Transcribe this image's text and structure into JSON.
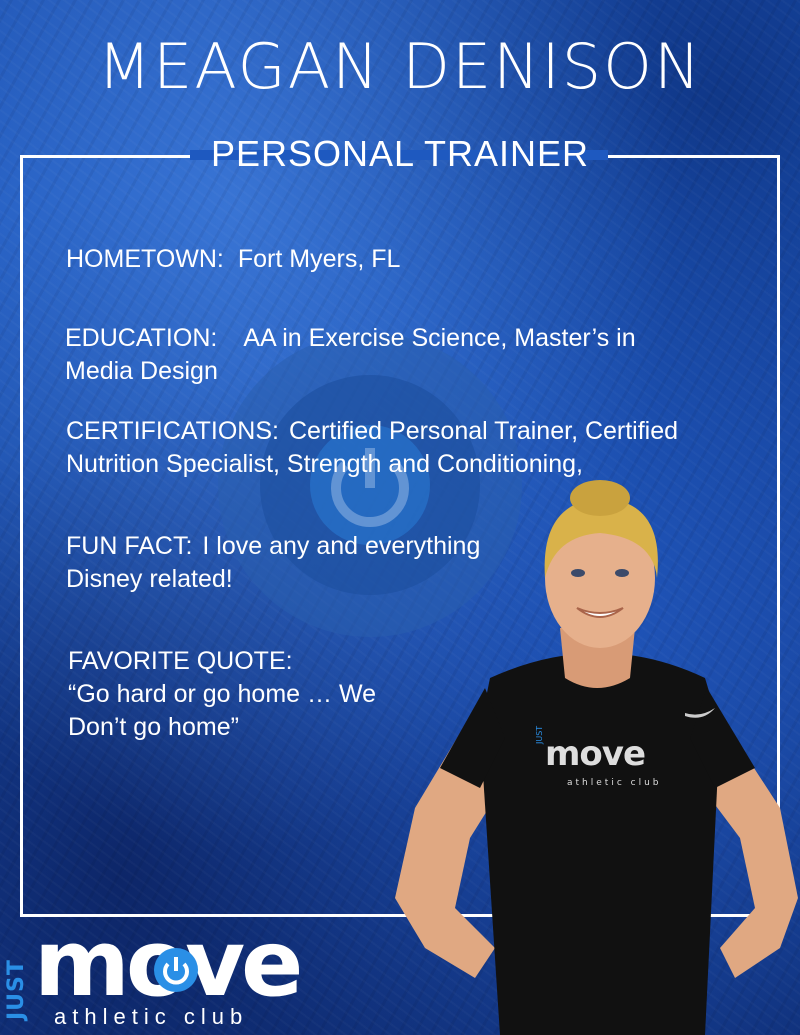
{
  "header": {
    "name": "MEAGAN DENISON",
    "role": "PERSONAL TRAINER"
  },
  "profile": {
    "hometown": {
      "label": "HOMETOWN:",
      "value": "Fort Myers, FL"
    },
    "education": {
      "label": "EDUCATION:",
      "value_line1": "AA in Exercise Science, Master’s in",
      "value_line2": "Media Design"
    },
    "certifications": {
      "label": "CERTIFICATIONS:",
      "value_line1": "Certified Personal Trainer, Certified",
      "value_line2": "Nutrition Specialist, Strength and Conditioning,"
    },
    "fun_fact": {
      "label": "FUN FACT:",
      "value_line1": "I love any and everything",
      "value_line2": "Disney related!"
    },
    "favorite_quote": {
      "label": "FAVORITE QUOTE:",
      "value_line1": "“Go hard or go home … We",
      "value_line2": "Don’t go home”"
    }
  },
  "shirt_logo": {
    "just": "JUST",
    "move": "move",
    "sub": "athletic club"
  },
  "logo": {
    "just": "JUST",
    "move": "move",
    "sub": "athletic club"
  },
  "colors": {
    "background": "#1e59c0",
    "accent": "#2a8fe6",
    "text": "#ffffff"
  }
}
